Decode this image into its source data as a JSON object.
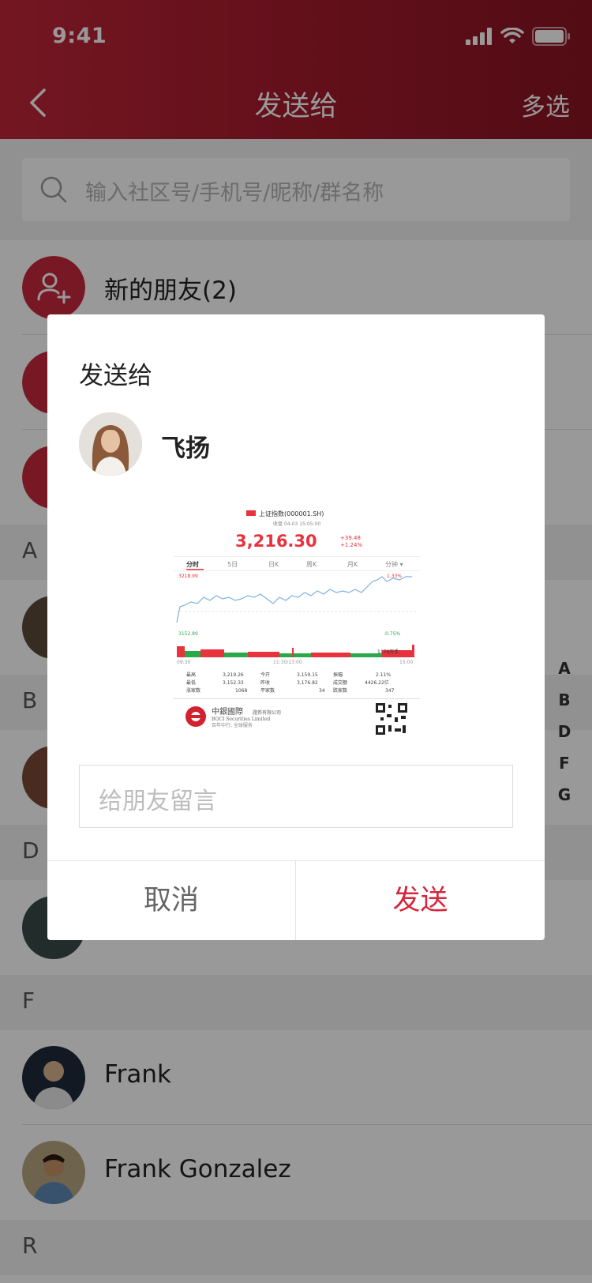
{
  "status_bar": {
    "time": "9:41"
  },
  "nav": {
    "title": "发送给",
    "right_action": "多选"
  },
  "search": {
    "placeholder": "输入社区号/手机号/昵称/群名称"
  },
  "list": {
    "new_friends": "新的朋友(2)",
    "sections": [
      "A",
      "B",
      "D",
      "F",
      "R"
    ],
    "contacts": [
      {
        "name": "Frank"
      },
      {
        "name": "Frank Gonzalez"
      }
    ]
  },
  "index_letters": [
    "A",
    "B",
    "D",
    "F",
    "G"
  ],
  "dialog": {
    "title": "发送给",
    "recipient": "飞扬",
    "message_placeholder": "给朋友留言",
    "cancel_label": "取消",
    "send_label": "发送",
    "preview": {
      "index_name": "上证指数(000001.SH)",
      "subtitle": "收盘 04-03 15:05:00",
      "price": "3,216.30",
      "change": "+39.48",
      "change_pct": "+1.24%",
      "tabs": [
        "分时",
        "5日",
        "日K",
        "周K",
        "月K",
        "分钟 ▾"
      ],
      "high_label": "3218.99",
      "high_pct": "1.33%",
      "low_label": "3152.89",
      "low_pct": "-0.75%",
      "volume_label": "1178万手",
      "time_start": "09:30",
      "time_mid": "11:30/13:00",
      "time_end": "15:00",
      "stats": [
        [
          "最高",
          "3,219.26",
          "今开",
          "3,159.15",
          "振幅",
          "2.11%"
        ],
        [
          "最低",
          "3,152.33",
          "昨收",
          "3,176.82",
          "成交额",
          "4426.22亿"
        ],
        [
          "涨家数",
          "1068",
          "平家数",
          "34",
          "跌家数",
          "347"
        ]
      ],
      "brand_cn": "中銀國際",
      "brand_cn_sub": "證券有限公司",
      "brand_en": "BOCI Securities Limited",
      "slogan": "百年中行, 全球服务"
    }
  },
  "colors": {
    "brand_red": "#c0263a",
    "send_red": "#d5263c",
    "rise_red": "#e8323c",
    "fall_green": "#2ba84a",
    "line_blue": "#7fb2e5"
  }
}
